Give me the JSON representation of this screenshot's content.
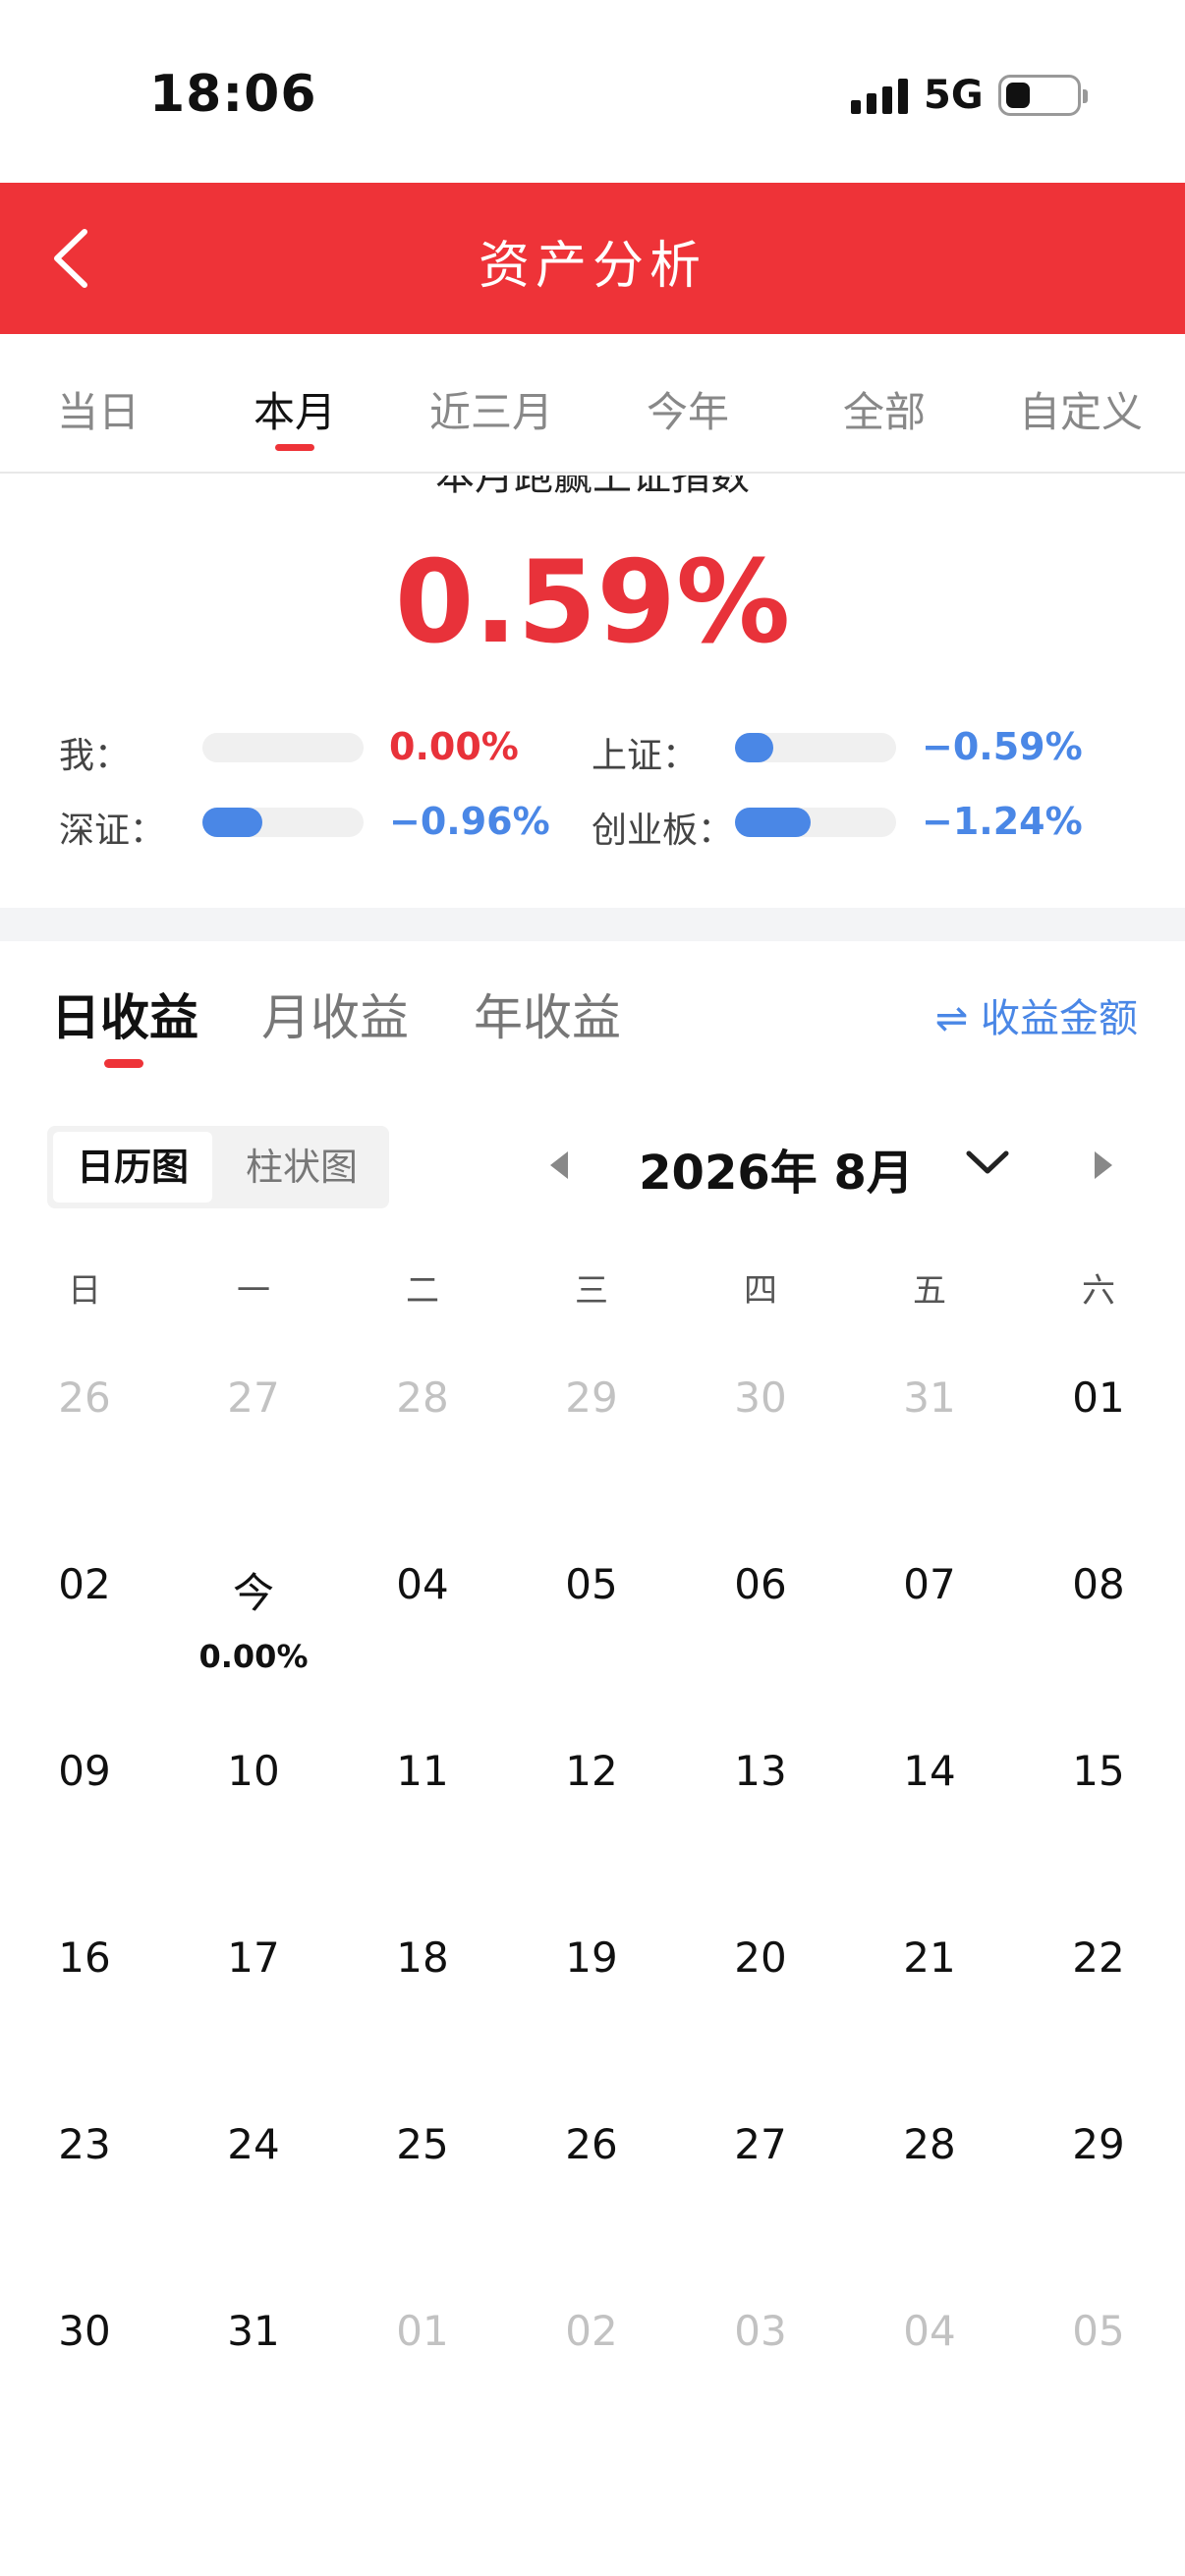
{
  "status": {
    "time": "18:06",
    "network": "5G"
  },
  "header": {
    "title": "资产分析"
  },
  "period_tabs": [
    "当日",
    "本月",
    "近三月",
    "今年",
    "全部",
    "自定义"
  ],
  "period_active": 1,
  "summary": {
    "caption": "本月跑赢上证指数",
    "big_value": "0.59%",
    "comparisons": [
      {
        "label": "我：",
        "value": "0.00%",
        "fill": 0.0,
        "color": "#e8323a"
      },
      {
        "label": "上证：",
        "value": "−0.59%",
        "fill": 0.24,
        "color": "#4a87e6"
      },
      {
        "label": "深证：",
        "value": "−0.96%",
        "fill": 0.37,
        "color": "#4a87e6"
      },
      {
        "label": "创业板：",
        "value": "−1.24%",
        "fill": 0.47,
        "color": "#4a87e6"
      }
    ]
  },
  "income_tabs": [
    "日收益",
    "月收益",
    "年收益"
  ],
  "amount_toggle": "⇌ 收益金额",
  "view_switch": {
    "calendar": "日历图",
    "bar": "柱状图"
  },
  "month_label": "2026年 8月",
  "weekdays": [
    "日",
    "一",
    "二",
    "三",
    "四",
    "五",
    "六"
  ],
  "calendar": [
    [
      {
        "d": "26",
        "m": true
      },
      {
        "d": "27",
        "m": true
      },
      {
        "d": "28",
        "m": true
      },
      {
        "d": "29",
        "m": true
      },
      {
        "d": "30",
        "m": true
      },
      {
        "d": "31",
        "m": true
      },
      {
        "d": "01",
        "m": false
      }
    ],
    [
      {
        "d": "02",
        "m": false
      },
      {
        "d": "今",
        "m": false,
        "sub": "0.00%"
      },
      {
        "d": "04",
        "m": false
      },
      {
        "d": "05",
        "m": false
      },
      {
        "d": "06",
        "m": false
      },
      {
        "d": "07",
        "m": false
      },
      {
        "d": "08",
        "m": false
      }
    ],
    [
      {
        "d": "09",
        "m": false
      },
      {
        "d": "10",
        "m": false
      },
      {
        "d": "11",
        "m": false
      },
      {
        "d": "12",
        "m": false
      },
      {
        "d": "13",
        "m": false
      },
      {
        "d": "14",
        "m": false
      },
      {
        "d": "15",
        "m": false
      }
    ],
    [
      {
        "d": "16",
        "m": false
      },
      {
        "d": "17",
        "m": false
      },
      {
        "d": "18",
        "m": false
      },
      {
        "d": "19",
        "m": false
      },
      {
        "d": "20",
        "m": false
      },
      {
        "d": "21",
        "m": false
      },
      {
        "d": "22",
        "m": false
      }
    ],
    [
      {
        "d": "23",
        "m": false
      },
      {
        "d": "24",
        "m": false
      },
      {
        "d": "25",
        "m": false
      },
      {
        "d": "26",
        "m": false
      },
      {
        "d": "27",
        "m": false
      },
      {
        "d": "28",
        "m": false
      },
      {
        "d": "29",
        "m": false
      }
    ],
    [
      {
        "d": "30",
        "m": false
      },
      {
        "d": "31",
        "m": false
      },
      {
        "d": "01",
        "m": true
      },
      {
        "d": "02",
        "m": true
      },
      {
        "d": "03",
        "m": true
      },
      {
        "d": "04",
        "m": true
      },
      {
        "d": "05",
        "m": true
      }
    ]
  ],
  "colors": {
    "brand_red": "#ee3338",
    "value_red": "#e8323a",
    "blue": "#4a87e6"
  }
}
